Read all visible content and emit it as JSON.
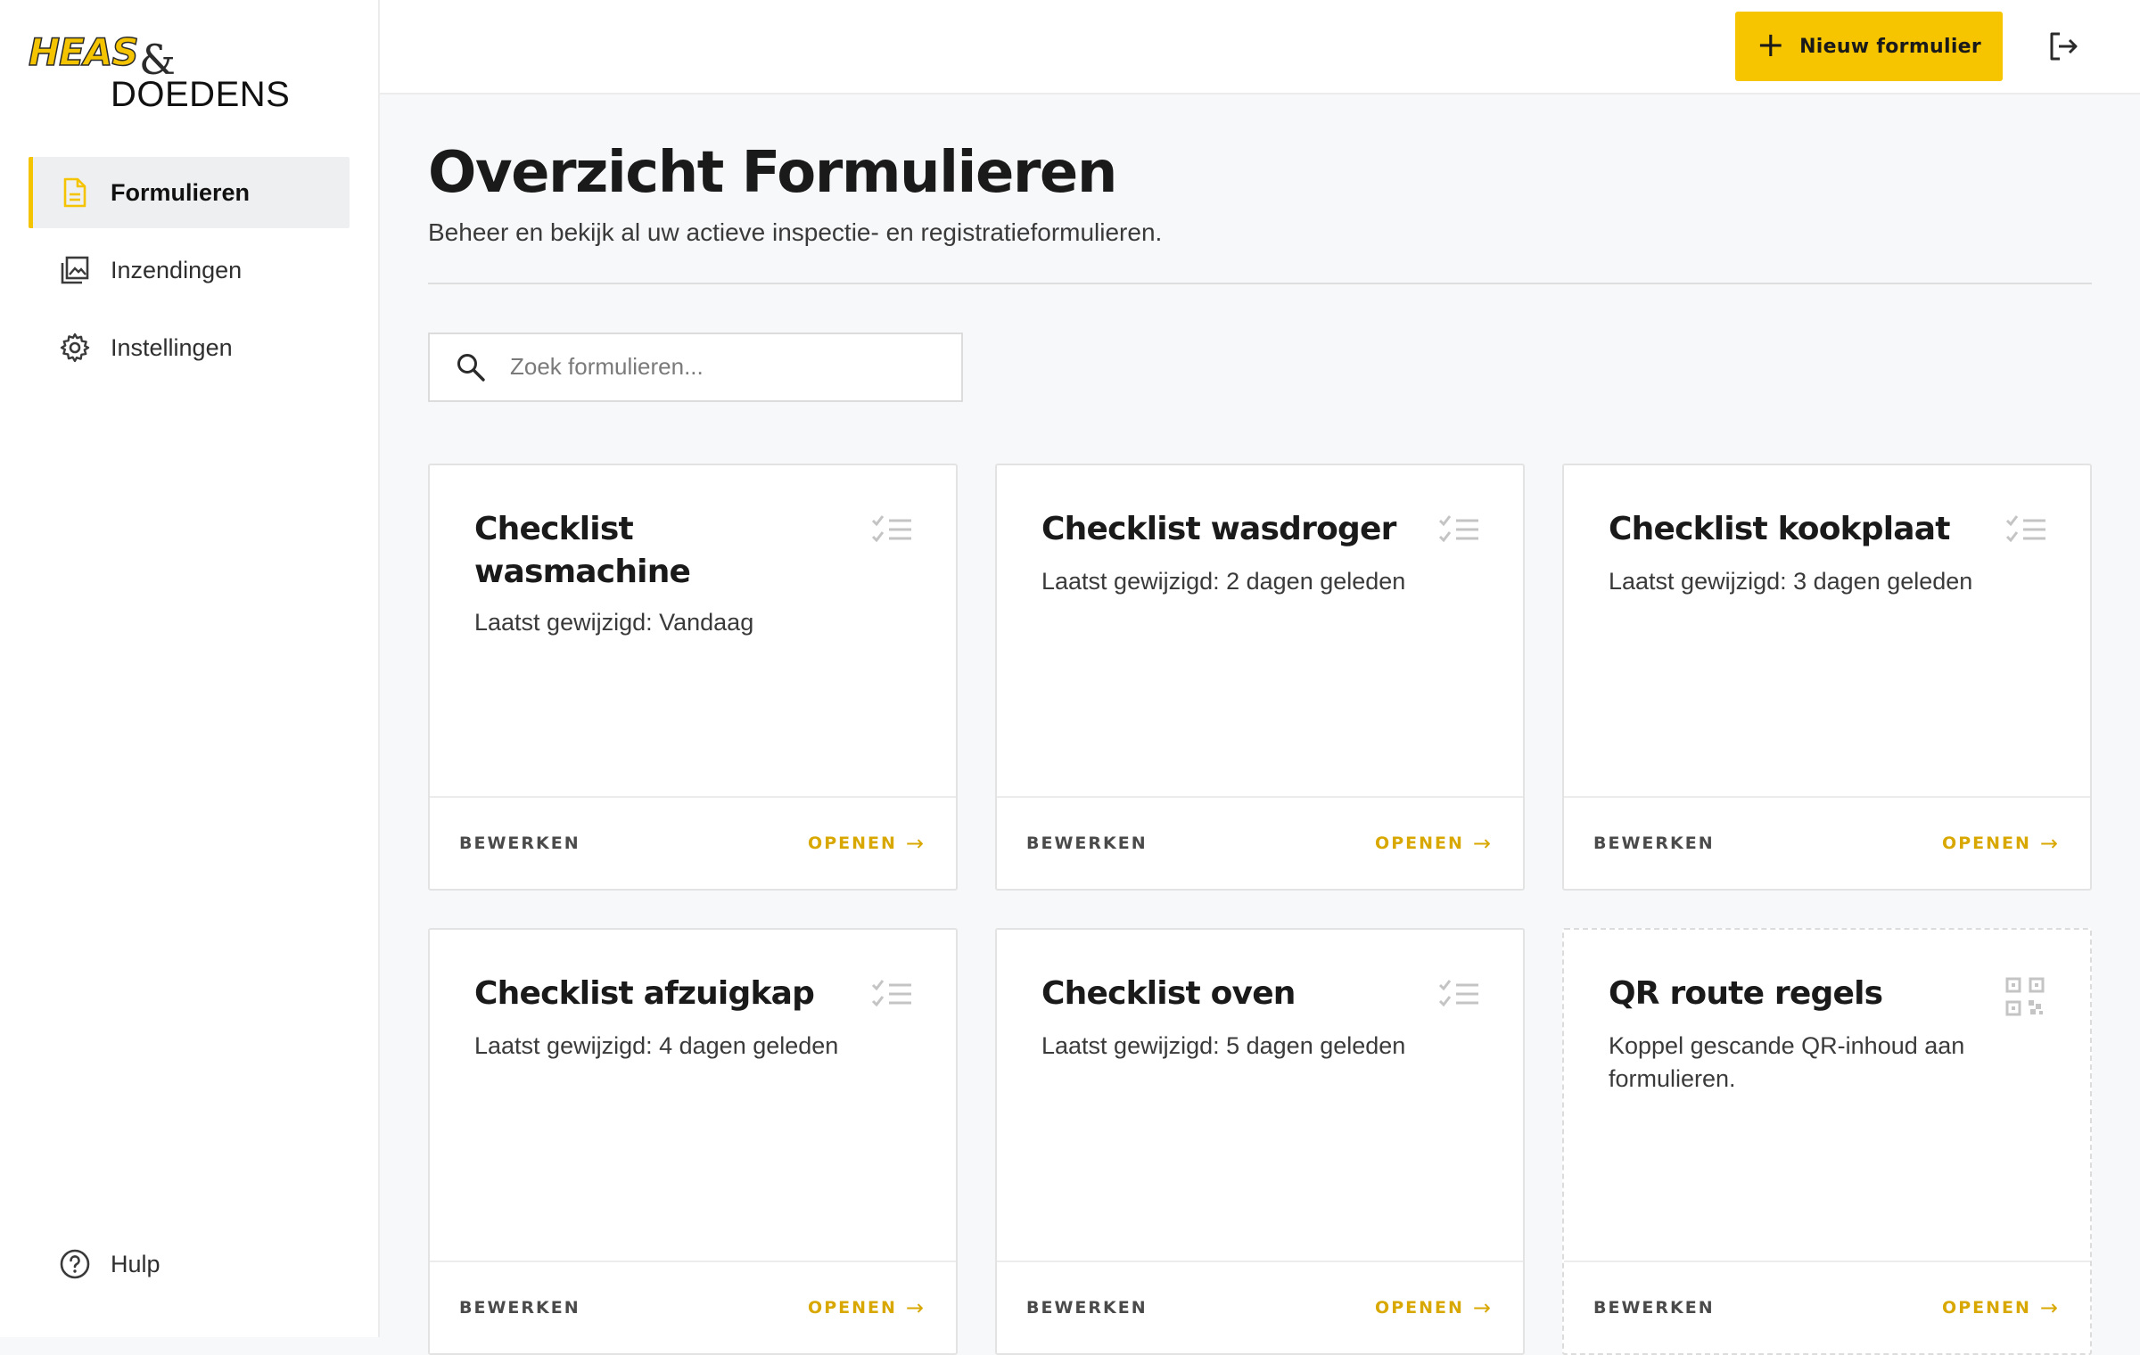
{
  "brand": {
    "line1": "HEAS",
    "amp": "&",
    "line2": "DOEDENS",
    "accent": "#f7c500"
  },
  "sidebar": {
    "items": [
      {
        "label": "Formulieren",
        "icon": "document-icon",
        "active": true
      },
      {
        "label": "Inzendingen",
        "icon": "gallery-icon",
        "active": false
      },
      {
        "label": "Instellingen",
        "icon": "gear-icon",
        "active": false
      }
    ],
    "help_label": "Hulp"
  },
  "topbar": {
    "new_button_label": "Nieuw formulier",
    "new_button_icon": "plus-icon",
    "logout_icon": "logout-icon"
  },
  "page": {
    "title": "Overzicht Formulieren",
    "subtitle": "Beheer en bekijk al uw actieve inspectie- en registratieformulieren."
  },
  "search": {
    "placeholder": "Zoek formulieren..."
  },
  "cards": [
    {
      "title": "Checklist wasmachine",
      "subtitle": "Laatst gewijzigd: Vandaag",
      "icon": "checklist-icon",
      "edit_label": "BEWERKEN",
      "open_label": "OPENEN"
    },
    {
      "title": "Checklist wasdroger",
      "subtitle": "Laatst gewijzigd: 2 dagen geleden",
      "icon": "checklist-icon",
      "edit_label": "BEWERKEN",
      "open_label": "OPENEN"
    },
    {
      "title": "Checklist kookplaat",
      "subtitle": "Laatst gewijzigd: 3 dagen geleden",
      "icon": "checklist-icon",
      "edit_label": "BEWERKEN",
      "open_label": "OPENEN"
    },
    {
      "title": "Checklist afzuigkap",
      "subtitle": "Laatst gewijzigd: 4 dagen geleden",
      "icon": "checklist-icon",
      "edit_label": "BEWERKEN",
      "open_label": "OPENEN"
    },
    {
      "title": "Checklist oven",
      "subtitle": "Laatst gewijzigd: 5 dagen geleden",
      "icon": "checklist-icon",
      "edit_label": "BEWERKEN",
      "open_label": "OPENEN"
    },
    {
      "title": "QR route regels",
      "subtitle": "Koppel gescande QR-inhoud aan formulieren.",
      "icon": "qr-code-icon",
      "edit_label": "BEWERKEN",
      "open_label": "OPENEN"
    }
  ]
}
